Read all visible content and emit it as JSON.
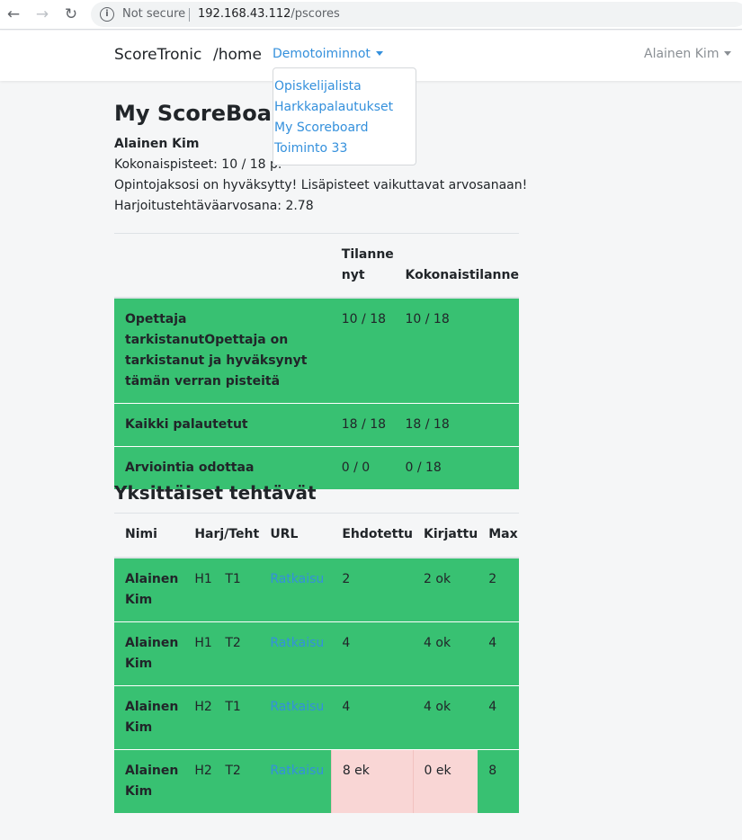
{
  "browser": {
    "security": "Not secure",
    "url_host": "192.168.43.112",
    "url_path": "/pscores"
  },
  "navbar": {
    "brand": "ScoreTronic",
    "home": "/home",
    "demo_menu": "Demotoiminnot",
    "user": "Alainen Kim",
    "dropdown_items": [
      "Opiskelijalista",
      "Harkkapalautukset",
      "My Scoreboard",
      "Toiminto 33"
    ]
  },
  "page": {
    "title": "My ScoreBoard",
    "student_name": "Alainen Kim",
    "total_points": "Kokonaispisteet: 10 / 18 p.",
    "status_message": "Opintojaksosi on hyväksytty! Lisäpisteet vaikuttavat arvosanaan!",
    "exercise_grade": "Harjoitustehtäväarvosana: 2.78"
  },
  "summary_table": {
    "headers": [
      "",
      "Tilanne nyt",
      "Kokonaistilanne"
    ],
    "rows": [
      {
        "label": "Opettaja tarkistanutOpettaja on tarkistanut ja hyväksynyt tämän verran pisteitä",
        "now": "10 / 18",
        "total": "10 / 18"
      },
      {
        "label": "Kaikki palautetut",
        "now": "18 / 18",
        "total": "18 / 18"
      },
      {
        "label": "Arviointia odottaa",
        "now": "0 / 0",
        "total": "0 / 18"
      }
    ]
  },
  "tasks": {
    "title": "Yksittäiset tehtävät",
    "headers": [
      "Nimi",
      "Harj/Teht",
      "URL",
      "Ehdotettu",
      "Kirjattu",
      "Max"
    ],
    "rows": [
      {
        "name": "Alainen Kim",
        "harj": "H1",
        "teht": "T1",
        "url": "Ratkaisu",
        "ehdotettu": "2",
        "kirjattu": "2 ok",
        "max": "2",
        "pending": false
      },
      {
        "name": "Alainen Kim",
        "harj": "H1",
        "teht": "T2",
        "url": "Ratkaisu",
        "ehdotettu": "4",
        "kirjattu": "4 ok",
        "max": "4",
        "pending": false
      },
      {
        "name": "Alainen Kim",
        "harj": "H2",
        "teht": "T1",
        "url": "Ratkaisu",
        "ehdotettu": "4",
        "kirjattu": "4 ok",
        "max": "4",
        "pending": false
      },
      {
        "name": "Alainen Kim",
        "harj": "H2",
        "teht": "T2",
        "url": "Ratkaisu",
        "ehdotettu": "8 ek",
        "kirjattu": "0 ek",
        "max": "8",
        "pending": true
      }
    ]
  },
  "colors": {
    "accepted_row": "#38c172",
    "pending_cell": "#f9d6d5",
    "link": "#3490dc"
  },
  "icons": [
    "back-arrow-icon",
    "forward-arrow-icon",
    "reload-icon",
    "info-icon",
    "caret-down-icon"
  ]
}
